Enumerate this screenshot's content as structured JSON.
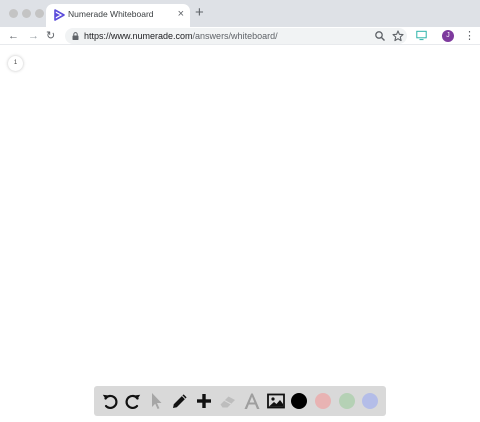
{
  "browser": {
    "tab_title": "Numerade Whiteboard",
    "tab_close": "×",
    "new_tab": "+",
    "url_host": "https://www.numerade.com",
    "url_path": "/answers/whiteboard/",
    "avatar_initial": "J",
    "nav": {
      "back": "←",
      "forward": "→",
      "reload": "↻",
      "menu": "⋮"
    }
  },
  "canvas": {
    "page_number": "1"
  },
  "palette": {
    "tools": [
      "undo-icon",
      "redo-icon",
      "select-icon",
      "pencil-icon",
      "add-icon",
      "eraser-icon",
      "text-icon",
      "image-icon"
    ],
    "colors": [
      "#000000",
      "#e8b3b3",
      "#b5d1b5",
      "#b4bde8"
    ]
  },
  "colors": {
    "accent_purple": "#7e3a9e",
    "favicon_blue": "#5b4cdb"
  }
}
